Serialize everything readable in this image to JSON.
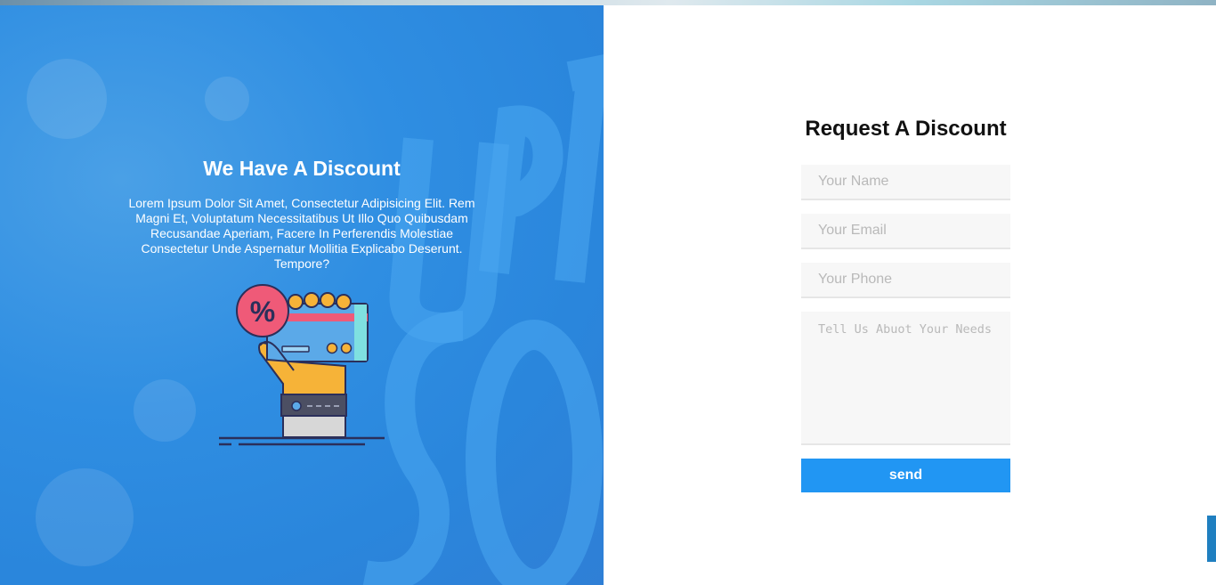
{
  "hero": {
    "title": "We Have A Discount",
    "body": "Lorem Ipsum Dolor Sit Amet, Consectetur Adipisicing Elit. Rem Magni Et, Voluptatum Necessitatibus Ut Illo Quo Quibusdam Recusandae Aperiam, Facere In Perferendis Molestiae Consectetur Unde Aspernatur Mollitia Explicabo Deserunt. Tempore?",
    "illustration_icon": "hand-holding-discount-card-icon"
  },
  "form": {
    "title": "Request A Discount",
    "name_placeholder": "Your Name",
    "email_placeholder": "Your Email",
    "phone_placeholder": "Your Phone",
    "needs_placeholder": "Tell Us Abuot Your Needs",
    "send_label": "send"
  },
  "colors": {
    "hero_background": "#2f8ee2",
    "button": "#2196f3",
    "field_background": "#f7f7f7"
  }
}
